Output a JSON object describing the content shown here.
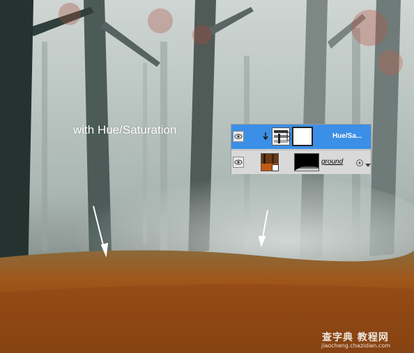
{
  "caption": "with Hue/Saturation",
  "layers_panel": {
    "layers": [
      {
        "name": "Hue/Sa...",
        "selected": true,
        "kind": "adjustment",
        "thumb_icon": "hue-saturation-adjustment-icon"
      },
      {
        "name": "ground",
        "selected": false,
        "kind": "smart-object",
        "thumb_icon": "forest-image-thumbnail"
      }
    ]
  },
  "watermark": {
    "main": "查字典 教程网",
    "sub": "jiaocheng.chazidian.com"
  },
  "colors": {
    "selection": "#3b8fe6",
    "panel": "#d6d6d6",
    "leaves": "#b5651d"
  }
}
